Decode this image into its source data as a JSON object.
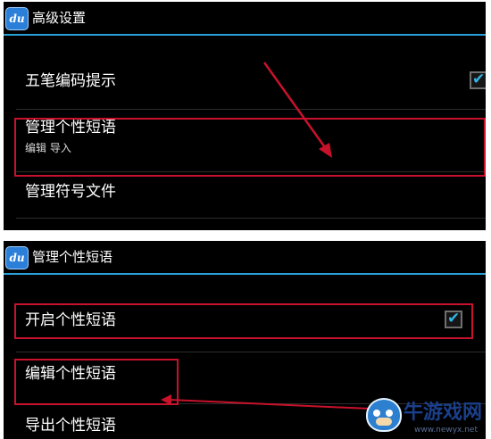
{
  "app_icon_text": "du",
  "screen_top": {
    "title": "高级设置",
    "items": [
      {
        "label": "五笔编码提示",
        "checked": true
      },
      {
        "label": "管理个性短语",
        "sub": "编辑  导入"
      },
      {
        "label": "管理符号文件"
      }
    ]
  },
  "screen_bottom": {
    "title": "管理个性短语",
    "items": [
      {
        "label": "开启个性短语",
        "checked": true
      },
      {
        "label": "编辑个性短语"
      },
      {
        "label": "导出个性短语"
      }
    ]
  },
  "checkmark_glyph": "✔",
  "watermark": {
    "name": "牛游戏网",
    "url": "www.newyx.net"
  },
  "colors": {
    "background": "#000000",
    "accent_line": "#2a9fd6",
    "checkmark": "#33b5e5",
    "highlight": "#c8122b"
  },
  "icons": [
    "du-app-icon",
    "checkbox-checked-icon",
    "annotation-arrow",
    "cow-mascot-logo"
  ]
}
